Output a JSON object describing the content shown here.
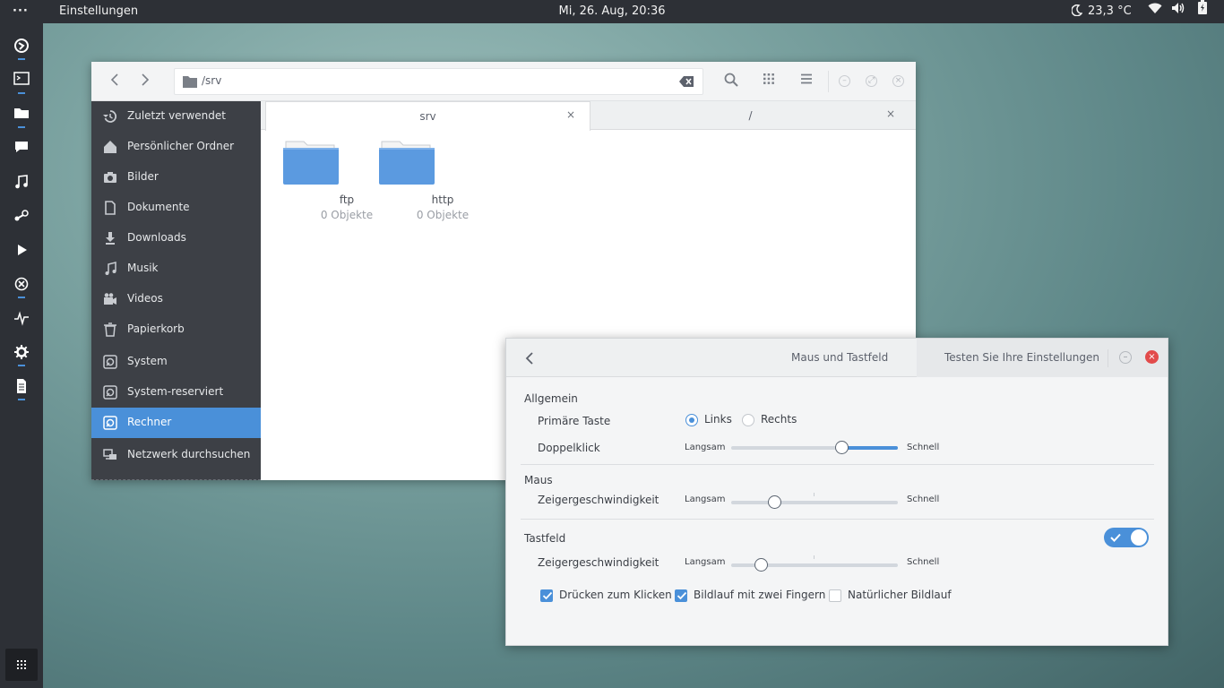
{
  "topbar": {
    "menu_dots": "···",
    "app_name": "Einstellungen",
    "clock": "Mi, 26. Aug, 20:36",
    "weather": "23,3 °C",
    "icons": [
      "moon-icon",
      "wifi-icon",
      "volume-icon",
      "battery-icon"
    ]
  },
  "dock": {
    "items": [
      "web-browser-icon",
      "terminal-icon",
      "files-icon",
      "chat-icon",
      "music-icon",
      "steam-icon",
      "video-player-icon",
      "system-monitor-icon",
      "activity-icon",
      "settings-icon",
      "text-editor-icon"
    ],
    "grid_icon": "app-grid-icon"
  },
  "file_manager": {
    "path": "/srv",
    "sidebar": [
      {
        "label": "Zuletzt verwendet",
        "icon": "recent-icon"
      },
      {
        "label": "Persönlicher Ordner",
        "icon": "home-icon"
      },
      {
        "label": "Bilder",
        "icon": "camera-icon"
      },
      {
        "label": "Dokumente",
        "icon": "document-icon"
      },
      {
        "label": "Downloads",
        "icon": "download-icon"
      },
      {
        "label": "Musik",
        "icon": "music-icon"
      },
      {
        "label": "Videos",
        "icon": "video-camera-icon"
      },
      {
        "label": "Papierkorb",
        "icon": "trash-icon"
      },
      {
        "label": "System",
        "icon": "drive-icon"
      },
      {
        "label": "System-reserviert",
        "icon": "drive-icon"
      },
      {
        "label": "Rechner",
        "icon": "drive-icon",
        "active": true
      },
      {
        "label": "Netzwerk durchsuchen",
        "icon": "network-icon"
      }
    ],
    "tabs": [
      {
        "label": "srv",
        "close": "×"
      },
      {
        "label": "/",
        "close": "×"
      }
    ],
    "folders": [
      {
        "name": "ftp",
        "count": "0 Objekte"
      },
      {
        "name": "http",
        "count": "0 Objekte"
      }
    ],
    "accent": "#4a90d9"
  },
  "settings": {
    "title": "Maus und Tastfeld",
    "test_button": "Testen Sie Ihre Einstellungen",
    "general": {
      "heading": "Allgemein",
      "primary_label": "Primäre Taste",
      "left": "Links",
      "right": "Rechts",
      "selected": "Links",
      "doubleclick_label": "Doppelklick",
      "doubleclick_level": 0.66
    },
    "mouse": {
      "heading": "Maus",
      "speed_label": "Zeigergeschwindigkeit",
      "speed_level": 0.26
    },
    "touchpad": {
      "heading": "Tastfeld",
      "enabled": true,
      "speed_label": "Zeigergeschwindigkeit",
      "speed_level": 0.18,
      "tap_to_click": "Drücken zum Klicken",
      "two_finger_scroll": "Bildlauf mit zwei Fingern",
      "natural_scroll": "Natürlicher Bildlauf",
      "tap_to_click_checked": true,
      "two_finger_scroll_checked": true,
      "natural_scroll_checked": false
    },
    "slow": "Langsam",
    "fast": "Schnell"
  }
}
